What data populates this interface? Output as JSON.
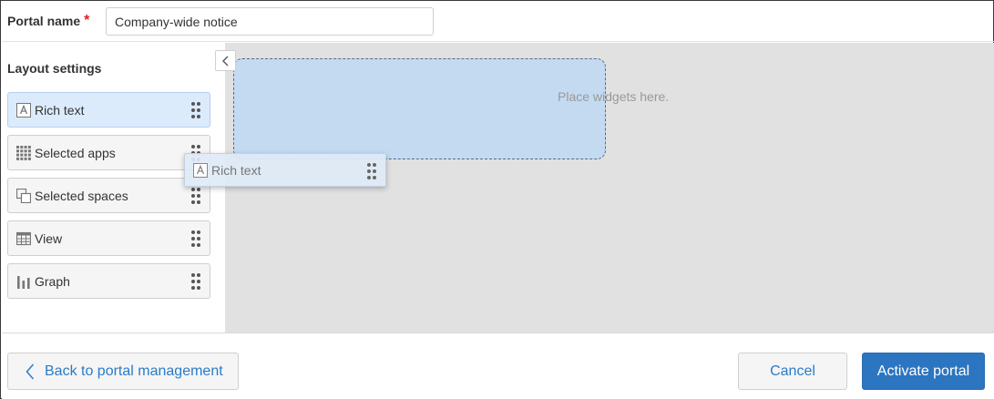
{
  "header": {
    "portal_name_label": "Portal name",
    "required_mark": "*",
    "portal_name_value": "Company-wide notice"
  },
  "sidebar": {
    "title": "Layout settings",
    "collapse_icon": "chevron-left-icon",
    "items": [
      {
        "label": "Rich text",
        "icon": "rich-text-icon",
        "selected": true
      },
      {
        "label": "Selected apps",
        "icon": "apps-grid-icon",
        "selected": false
      },
      {
        "label": "Selected spaces",
        "icon": "spaces-icon",
        "selected": false
      },
      {
        "label": "View",
        "icon": "table-view-icon",
        "selected": false
      },
      {
        "label": "Graph",
        "icon": "bar-graph-icon",
        "selected": false
      }
    ]
  },
  "canvas": {
    "placeholder": "Place widgets here.",
    "drag_ghost_label": "Rich text"
  },
  "footer": {
    "back_label": "Back to portal management",
    "cancel_label": "Cancel",
    "activate_label": "Activate portal"
  },
  "colors": {
    "accent": "#2c75c0",
    "link": "#2a7bc8",
    "selected_item_bg": "#dcebfb",
    "drop_zone_bg": "#c4daf1",
    "canvas_bg": "#e1e1e1",
    "required": "#e02020"
  }
}
